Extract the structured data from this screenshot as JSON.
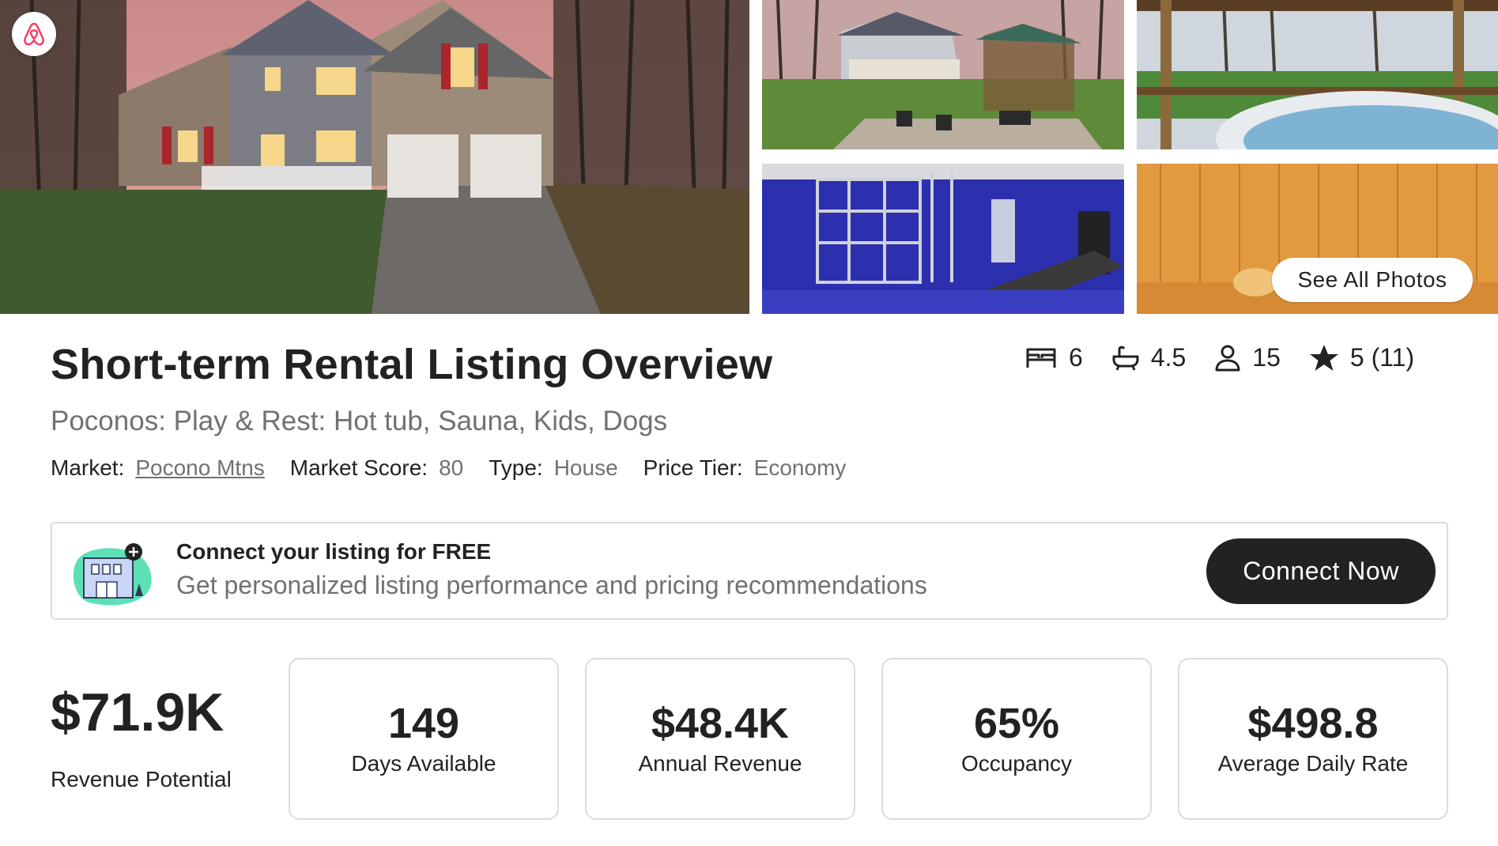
{
  "gallery": {
    "see_all_label": "See All Photos"
  },
  "listing": {
    "title": "Short-term Rental Listing Overview",
    "subtitle": "Poconos: Play & Rest: Hot tub, Sauna, Kids, Dogs",
    "meta": {
      "market_label": "Market:",
      "market_value": "Pocono Mtns",
      "score_label": "Market Score:",
      "score_value": "80",
      "type_label": "Type:",
      "type_value": "House",
      "tier_label": "Price Tier:",
      "tier_value": "Economy"
    },
    "stats": {
      "bedrooms": "6",
      "bathrooms": "4.5",
      "guests": "15",
      "rating": "5 (11)"
    }
  },
  "banner": {
    "title": "Connect your listing for FREE",
    "description": "Get personalized listing performance and pricing recommendations",
    "button_label": "Connect Now"
  },
  "metrics": {
    "revenue_potential": {
      "value": "$71.9K",
      "label": "Revenue Potential"
    },
    "cards": [
      {
        "value": "149",
        "label": "Days Available"
      },
      {
        "value": "$48.4K",
        "label": "Annual Revenue"
      },
      {
        "value": "65%",
        "label": "Occupancy"
      },
      {
        "value": "$498.8",
        "label": "Average Daily Rate"
      }
    ]
  },
  "colors": {
    "text_primary": "#222222",
    "text_secondary": "#717171",
    "border": "#dcdcdc",
    "button_dark": "#222222",
    "brand": "#FF385C"
  }
}
